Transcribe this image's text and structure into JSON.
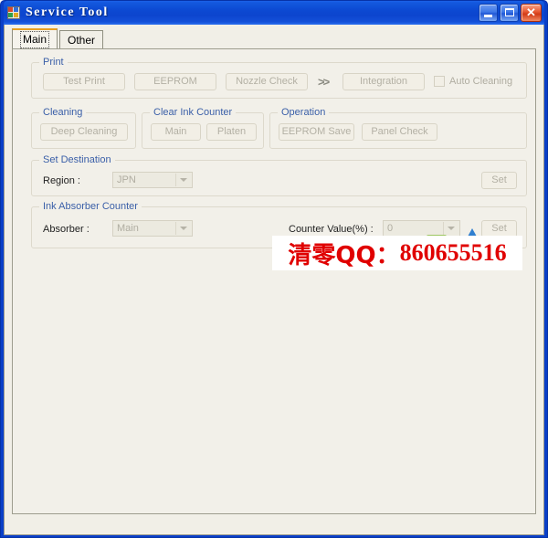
{
  "window": {
    "title": "Service Tool",
    "icon": "app-icon",
    "caption_buttons": [
      {
        "name": "minimize",
        "glyph": "_"
      },
      {
        "name": "maximize",
        "glyph": "□"
      },
      {
        "name": "close",
        "glyph": "✕"
      }
    ]
  },
  "tabs": [
    {
      "label": "Main",
      "selected": true
    },
    {
      "label": "Other",
      "selected": false
    }
  ],
  "groups": {
    "print": {
      "title": "Print",
      "buttons": [
        {
          "label": "Test Print",
          "disabled": true
        },
        {
          "label": "EEPROM",
          "disabled": true
        },
        {
          "label": "Nozzle Check",
          "disabled": true
        },
        {
          "label": "Integration",
          "disabled": true
        }
      ],
      "separator": ">>",
      "checkbox": {
        "label": "Auto Cleaning",
        "checked": false,
        "disabled": true
      }
    },
    "cleaning": {
      "title": "Cleaning",
      "buttons": [
        {
          "label": "Deep Cleaning",
          "disabled": true
        }
      ]
    },
    "clear_ink_counter": {
      "title": "Clear Ink Counter",
      "buttons": [
        {
          "label": "Main",
          "disabled": true
        },
        {
          "label": "Platen",
          "disabled": true
        }
      ]
    },
    "operation": {
      "title": "Operation",
      "buttons": [
        {
          "label": "EEPROM Save",
          "disabled": true
        },
        {
          "label": "Panel Check",
          "disabled": true
        }
      ]
    },
    "set_destination": {
      "title": "Set Destination",
      "region_label": "Region :",
      "region_value": "JPN",
      "set_label": "Set"
    },
    "ink_absorber_counter": {
      "title": "Ink Absorber Counter",
      "absorber_label": "Absorber :",
      "absorber_value": "Main",
      "counter_label": "Counter Value(%) :",
      "counter_value": "0",
      "set_label": "Set"
    }
  },
  "watermark": {
    "chinese": "清零QQ：",
    "number": "860655516",
    "color": "#e00000"
  },
  "colors": {
    "titlebar_blue": "#0c49d2",
    "window_border": "#0a3fc8",
    "client_bg": "#f1efe7",
    "group_title": "#3a5fa8",
    "disabled_text": "#b3b0a4",
    "tab_accent": "#e8a020"
  }
}
